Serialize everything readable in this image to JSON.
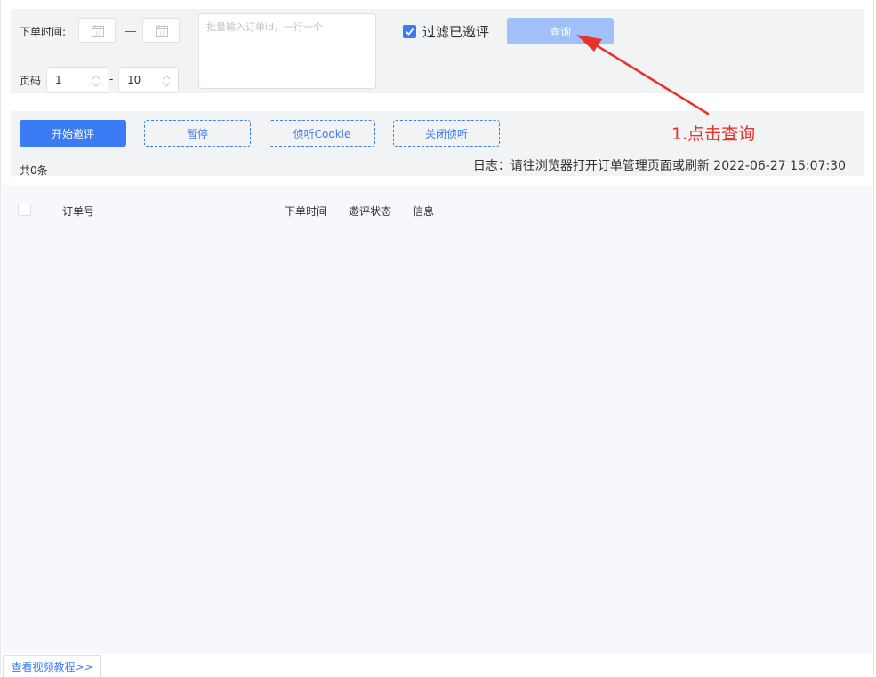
{
  "filter": {
    "order_time_label": "下单时间:",
    "page_label": "页码",
    "page_from": "1",
    "page_sep": "-",
    "page_to": "10",
    "batch_placeholder": "批量输入订单id，一行一个",
    "filter_checkbox_label": "过滤已邀评",
    "filter_checked": true,
    "query_button": "查询"
  },
  "actions": {
    "start_invite": "开始邀评",
    "pause": "暂停",
    "listen_cookie": "侦听Cookie",
    "close_listen": "关闭侦听",
    "total": "共0条",
    "log": "日志：请往浏览器打开订单管理页面或刷新 2022-06-27 15:07:30"
  },
  "table": {
    "columns": [
      "订单号",
      "下单时间",
      "邀评状态",
      "信息"
    ],
    "rows": []
  },
  "footer": {
    "tutorial_link": "查看视频教程>>"
  },
  "annotation": {
    "text": "1.点击查询",
    "color": "#e8322b"
  },
  "colors": {
    "primary": "#3b7cf5",
    "query_disabled": "#a0c1f7",
    "panel_bg": "#f2f3f5",
    "table_bg": "#f6f8fb"
  }
}
